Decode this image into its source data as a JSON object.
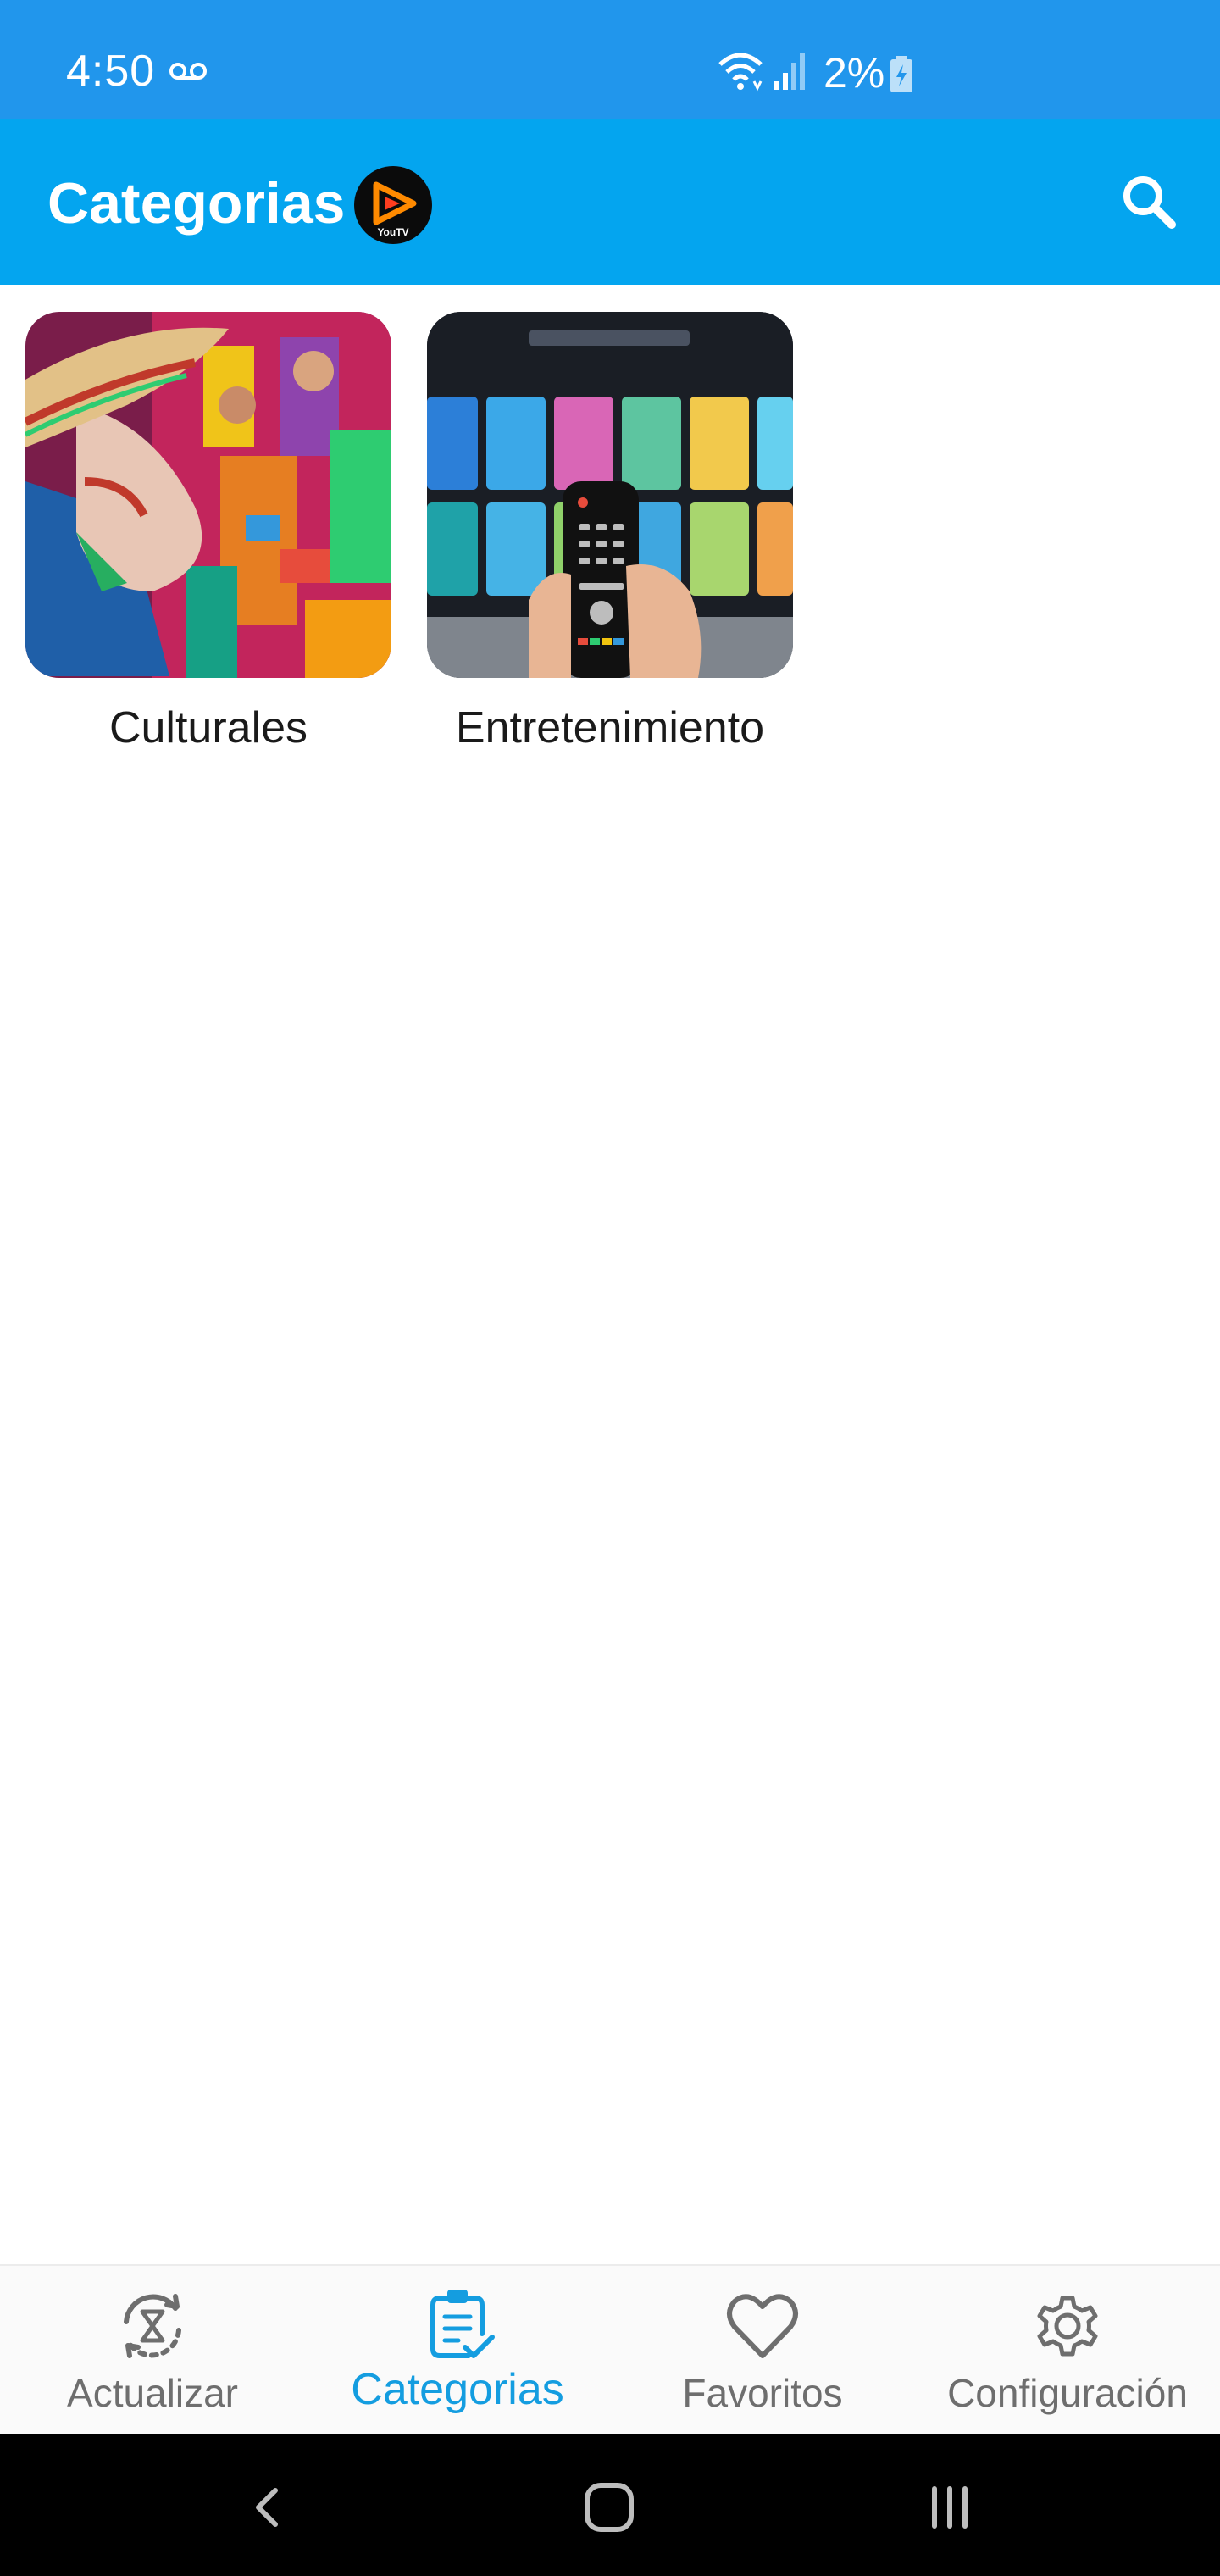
{
  "status_bar": {
    "time": "4:50",
    "battery_percent": "2%",
    "icons": [
      "voicemail-icon",
      "wifi-icon",
      "signal-icon",
      "battery-charging-icon"
    ]
  },
  "app_bar": {
    "title": "Categorias",
    "logo_text": "YouTV",
    "icons": [
      "youtv-logo",
      "search-icon"
    ]
  },
  "categories": [
    {
      "label": "Culturales",
      "image": "cultural-festival-photo"
    },
    {
      "label": "Entretenimiento",
      "image": "tv-remote-photo"
    }
  ],
  "bottom_nav": {
    "items": [
      {
        "label": "Actualizar",
        "icon": "refresh-hourglass-icon",
        "active": false
      },
      {
        "label": "Categorias",
        "icon": "clipboard-check-icon",
        "active": true
      },
      {
        "label": "Favoritos",
        "icon": "heart-icon",
        "active": false
      },
      {
        "label": "Configuración",
        "icon": "gear-icon",
        "active": false
      }
    ]
  },
  "system_nav": {
    "icons": [
      "back-icon",
      "home-icon",
      "recents-icon"
    ]
  },
  "colors": {
    "status_bar": "#2196ec",
    "app_bar": "#04a5ef",
    "active_nav": "#149de0",
    "inactive_nav": "#6e6e6e"
  }
}
